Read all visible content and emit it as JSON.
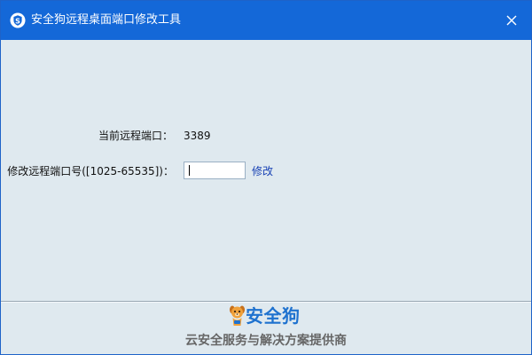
{
  "window": {
    "title": "安全狗远程桌面端口修改工具",
    "app_icon": "shield-s-icon",
    "close_icon": "close-icon",
    "colors": {
      "titlebar": "#1468d8",
      "background": "#dfe9ef",
      "link": "#1a43b5",
      "brand": "#1f72cf"
    }
  },
  "form": {
    "current_port_label": "当前远程端口：",
    "current_port_value": "3389",
    "modify_port_label": "修改远程端口号([1025-65535])：",
    "modify_port_input_value": "",
    "modify_link": "修改"
  },
  "footer": {
    "brand_name": "安全狗",
    "brand_icon": "dog-mascot-icon",
    "slogan": "云安全服务与解决方案提供商"
  }
}
